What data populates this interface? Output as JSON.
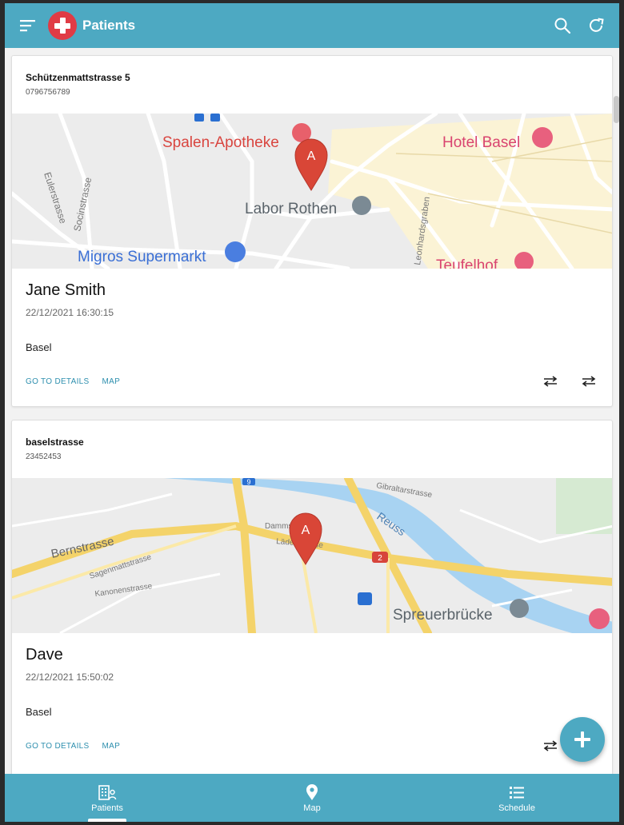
{
  "app": {
    "title": "Patients"
  },
  "icons": {
    "menu": "menu-icon",
    "search": "search-icon",
    "refresh": "refresh-icon",
    "add": "plus-icon",
    "swap": "swap-horiz-icon"
  },
  "colors": {
    "primary": "#4da9c2",
    "logo": "#e03b45",
    "link": "#2e8fae"
  },
  "patients": [
    {
      "address": "Schützenmattstrasse 5",
      "phone": "0796756789",
      "name": "Jane Smith",
      "datetime": "22/12/2021 16:30:15",
      "city": "Basel",
      "details_label": "GO TO DETAILS",
      "map_label": "MAP",
      "map_labels": {
        "pharmacy": "Spalen-Apotheke",
        "hotel": "Hotel Basel",
        "lab": "Labor Rothen",
        "supermarket": "Migros Supermarkt",
        "hotel2": "Teufelhof",
        "street1": "Eulerstrasse",
        "street2": "Socinstrasse",
        "street3": "Leonhardsgraben",
        "marker": "A"
      }
    },
    {
      "address": "baselstrasse",
      "phone": "23452453",
      "name": "Dave",
      "datetime": "22/12/2021 15:50:02",
      "city": "Basel",
      "details_label": "GO TO DETAILS",
      "map_label": "MAP",
      "map_labels": {
        "street1": "Bernstrasse",
        "street2": "Sagenmattstrasse",
        "street3": "Kanonenstrasse",
        "street4": "Dammstrasse",
        "street5": "Lädelistrasse",
        "river": "Reuss",
        "bridge": "Spreuerbrücke",
        "street6": "Gibraltarstrasse",
        "route_9": "9",
        "route_2": "2",
        "marker": "A"
      }
    }
  ],
  "bottom_nav": [
    {
      "label": "Patients",
      "active": true
    },
    {
      "label": "Map",
      "active": false
    },
    {
      "label": "Schedule",
      "active": false
    }
  ]
}
